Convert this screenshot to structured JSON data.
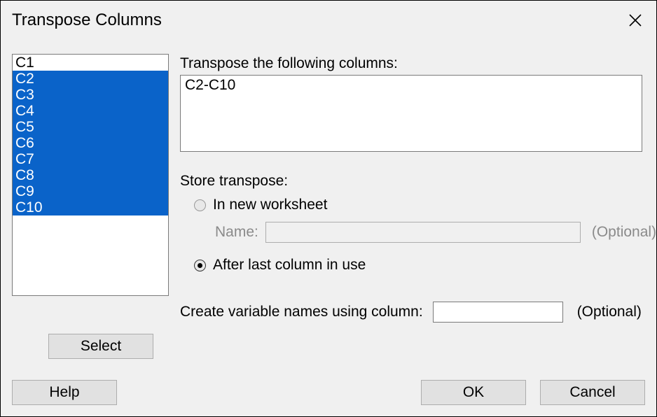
{
  "window": {
    "title": "Transpose Columns"
  },
  "columnList": {
    "items": [
      {
        "label": "C1",
        "selected": false
      },
      {
        "label": "C2",
        "selected": true
      },
      {
        "label": "C3",
        "selected": true
      },
      {
        "label": "C4",
        "selected": true
      },
      {
        "label": "C5",
        "selected": true
      },
      {
        "label": "C6",
        "selected": true
      },
      {
        "label": "C7",
        "selected": true
      },
      {
        "label": "C8",
        "selected": true
      },
      {
        "label": "C9",
        "selected": true
      },
      {
        "label": "C10",
        "selected": true
      }
    ]
  },
  "transpose": {
    "label": "Transpose the following columns:",
    "value": "C2-C10"
  },
  "store": {
    "label": "Store transpose:",
    "newWorksheet": {
      "label": "In new worksheet",
      "checked": false,
      "nameLabel": "Name:",
      "nameValue": "",
      "optional": "(Optional)"
    },
    "afterLast": {
      "label": "After last column in use",
      "checked": true
    }
  },
  "createVar": {
    "label": "Create variable names using column:",
    "value": "",
    "optional": "(Optional)"
  },
  "buttons": {
    "select": "Select",
    "help": "Help",
    "ok": "OK",
    "cancel": "Cancel"
  }
}
